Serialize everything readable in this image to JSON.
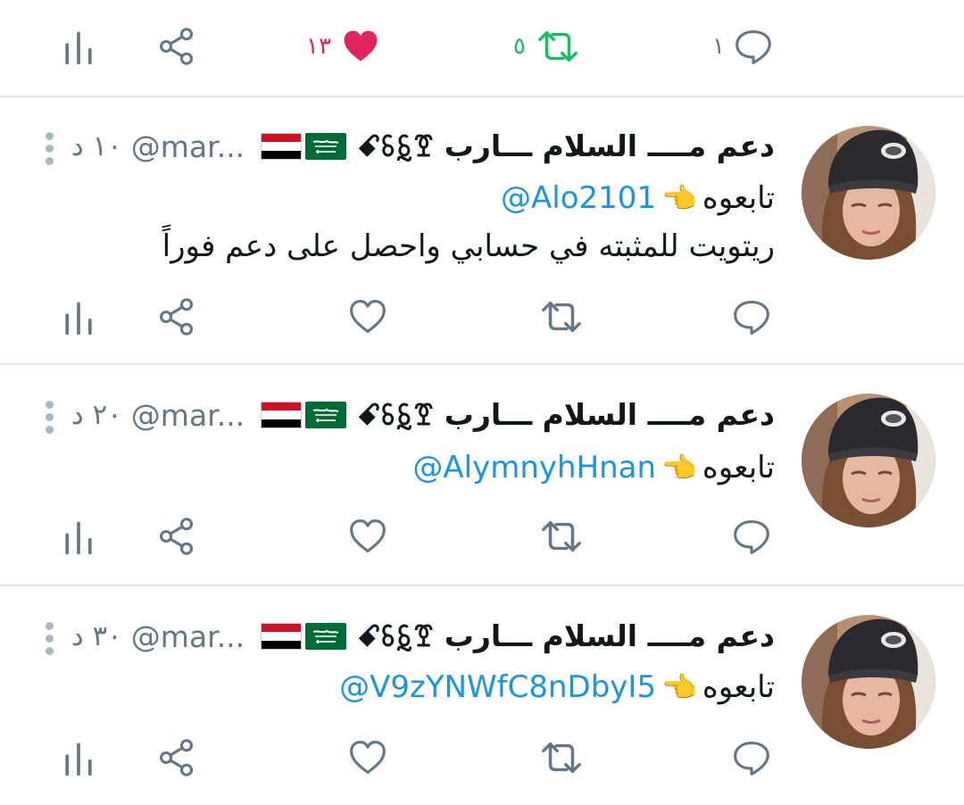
{
  "top_actions": {
    "reply_count": "١",
    "retweet_count": "٥",
    "like_count": "١٣"
  },
  "tweets": [
    {
      "display_name": "دعم مــــ السلام ـــارب ꗃꗏꗐꗑ",
      "handle": "@mar...",
      "time": "١٠ د",
      "mention": "@Alo2101",
      "follow_text": "تابعوه",
      "point_emoji": "👈",
      "body": "ريتويت للمثبته في حسابي واحصل على دعم فوراً"
    },
    {
      "display_name": "دعم مــــ السلام ـــارب ꗃꗏꗐꗑ",
      "handle": "@mar...",
      "time": "٢٠ د",
      "mention": "@AlymnyhHnan",
      "follow_text": "تابعوه",
      "point_emoji": "👈"
    },
    {
      "display_name": "دعم مــــ السلام ـــارب ꗃꗏꗐꗑ",
      "handle": "@mar...",
      "time": "٣٠ د",
      "mention": "@V9zYNWfC8nDbyI5",
      "follow_text": "تابعوه",
      "point_emoji": "👈"
    }
  ],
  "colors": {
    "icon_gray": "#657786",
    "like_pink": "#e0245e",
    "retweet_green": "#17bf63",
    "link_blue": "#1b95e0",
    "divider": "#e1e8ed"
  },
  "icons": [
    "reply-icon",
    "retweet-icon",
    "like-icon",
    "share-icon",
    "analytics-icon",
    "more-icon"
  ]
}
